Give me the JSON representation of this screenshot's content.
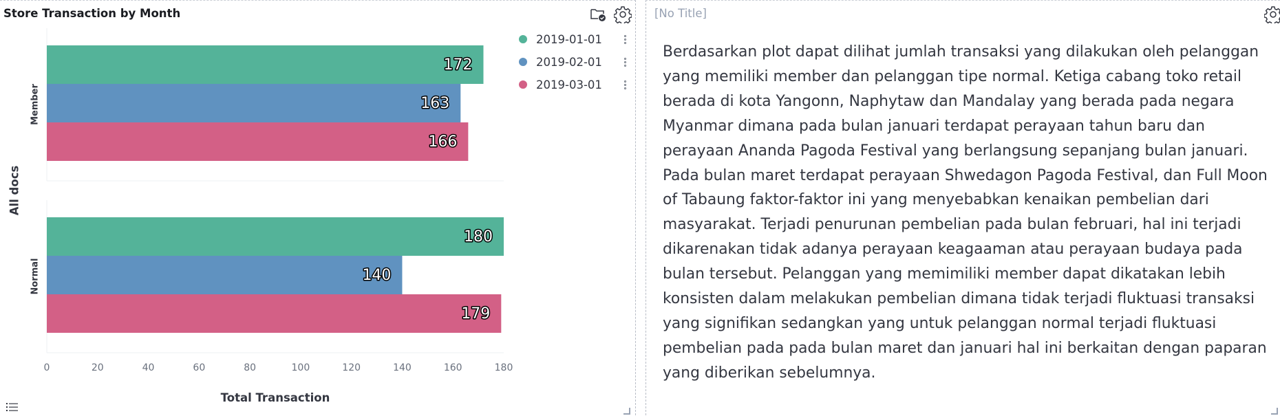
{
  "left_panel": {
    "title": "Store Transaction by Month",
    "icons": [
      "folder-check-icon",
      "gear-icon"
    ],
    "legend": [
      {
        "label": "2019-01-01",
        "color": "#54b399"
      },
      {
        "label": "2019-02-01",
        "color": "#6092c0"
      },
      {
        "label": "2019-03-01",
        "color": "#d36086"
      }
    ],
    "footer_icon": "list-icon"
  },
  "chart_data": {
    "type": "bar",
    "orientation": "horizontal",
    "title": "Store Transaction by Month",
    "split_label": "All docs",
    "xlabel": "Total Transaction",
    "xlim": [
      0,
      180
    ],
    "xticks": [
      0,
      20,
      40,
      60,
      80,
      100,
      120,
      140,
      160,
      180
    ],
    "legend_position": "top-right",
    "groups": [
      "Member",
      "Normal"
    ],
    "series": [
      {
        "name": "2019-01-01",
        "color": "#54b399",
        "values": [
          172,
          180
        ]
      },
      {
        "name": "2019-02-01",
        "color": "#6092c0",
        "values": [
          163,
          140
        ]
      },
      {
        "name": "2019-03-01",
        "color": "#d36086",
        "values": [
          166,
          179
        ]
      }
    ]
  },
  "right_panel": {
    "title": "[No Title]",
    "icons": [
      "gear-icon"
    ],
    "text": "Berdasarkan plot dapat dilihat jumlah transaksi yang dilakukan oleh pelanggan yang memiliki member dan pelanggan tipe normal. Ketiga cabang toko retail berada di kota Yangonn, Naphytaw dan Mandalay yang berada pada negara Myanmar dimana pada bulan januari terdapat perayaan tahun baru dan perayaan Ananda Pagoda Festival yang berlangsung sepanjang bulan januari. Pada bulan maret terdapat perayaan Shwedagon Pagoda Festival, dan Full Moon of Tabaung faktor-faktor ini yang menyebabkan kenaikan pembelian dari masyarakat. Terjadi penurunan pembelian pada bulan februari, hal ini terjadi dikarenakan tidak adanya perayaan keagaaman atau perayaan budaya pada bulan tersebut. Pelanggan yang memimiliki member dapat dikatakan lebih konsisten dalam melakukan pembelian dimana tidak terjadi fluktuasi transaksi yang signifikan sedangkan yang untuk pelanggan normal terjadi fluktuasi pembelian pada pada bulan maret dan januari hal ini berkaitan dengan paparan yang diberikan sebelumnya."
  }
}
